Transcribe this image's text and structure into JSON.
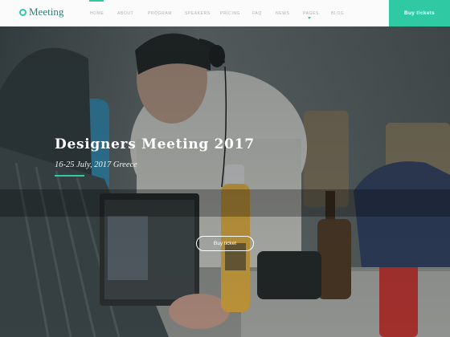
{
  "header": {
    "logo_text": "Meeting",
    "nav": [
      {
        "label": "Home",
        "active": true
      },
      {
        "label": "About"
      },
      {
        "label": "Program"
      },
      {
        "label": "Speakers"
      },
      {
        "label": "Pricing"
      },
      {
        "label": "FAQ"
      },
      {
        "label": "News"
      },
      {
        "label": "Pages",
        "dropdown": true
      },
      {
        "label": "Blog"
      }
    ],
    "buy_tickets_label": "Buy tickets"
  },
  "hero": {
    "title": "Designers Meeting 2017",
    "subtitle": "16-25 July, 2017 Greece",
    "cta_label": "Buy ticket"
  },
  "colors": {
    "accent": "#2fcaa4",
    "header_bg": "#fbfbfb",
    "nav_text": "#a9b1b1"
  },
  "icons": [
    "logo-ring-icon",
    "dropdown-caret-icon"
  ]
}
